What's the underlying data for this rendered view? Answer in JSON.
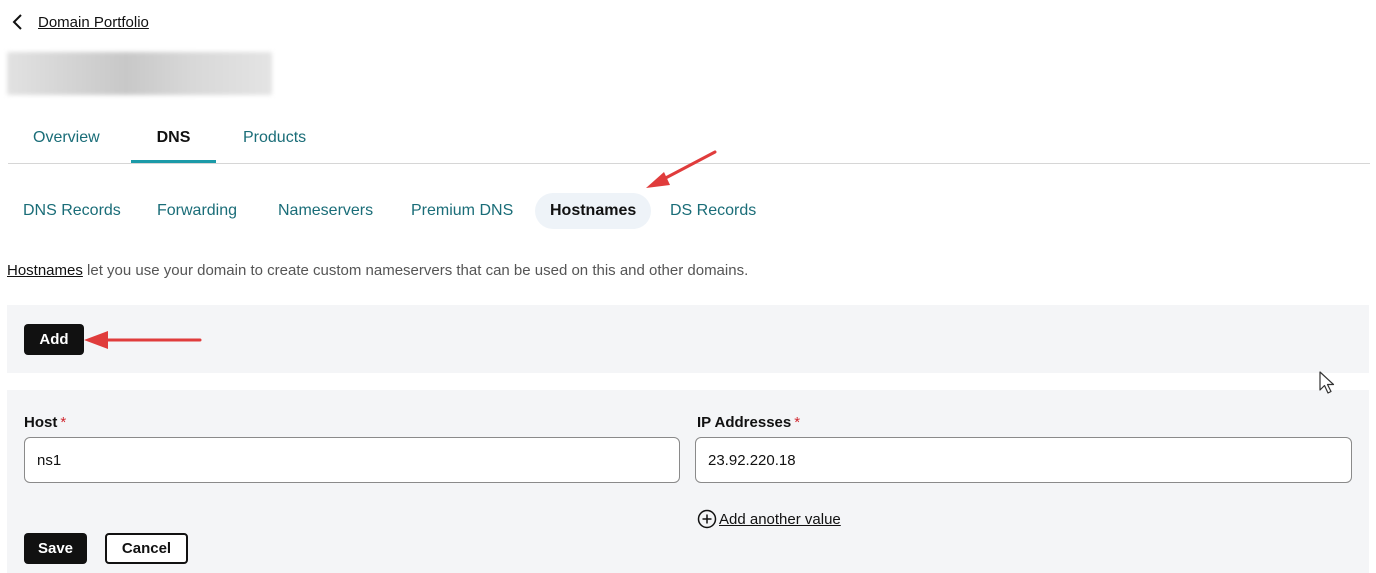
{
  "back_link": {
    "label": "Domain Portfolio"
  },
  "main_tabs": [
    {
      "label": "Overview",
      "active": false
    },
    {
      "label": "DNS",
      "active": true
    },
    {
      "label": "Products",
      "active": false
    }
  ],
  "sub_tabs": [
    {
      "label": "DNS Records",
      "active": false
    },
    {
      "label": "Forwarding",
      "active": false
    },
    {
      "label": "Nameservers",
      "active": false
    },
    {
      "label": "Premium DNS",
      "active": false
    },
    {
      "label": "Hostnames",
      "active": true
    },
    {
      "label": "DS Records",
      "active": false
    }
  ],
  "description": {
    "link_text": "Hostnames",
    "text": " let you use your domain to create custom nameservers that can be used on this and other domains."
  },
  "add_button": {
    "label": "Add"
  },
  "form": {
    "host_label": "Host",
    "host_value": "ns1",
    "ip_label": "IP Addresses",
    "ip_value": "23.92.220.18",
    "required_marker": "*",
    "add_value_label": "Add another value",
    "save_label": "Save",
    "cancel_label": "Cancel"
  },
  "colors": {
    "accent": "#1b9aa8",
    "link_teal": "#1a6d78",
    "annotation_arrow": "#e03c3c",
    "required": "#d0272f"
  },
  "icons": [
    "chevron-left-icon",
    "plus-circle-icon",
    "mouse-cursor-icon",
    "annotation-arrow"
  ]
}
